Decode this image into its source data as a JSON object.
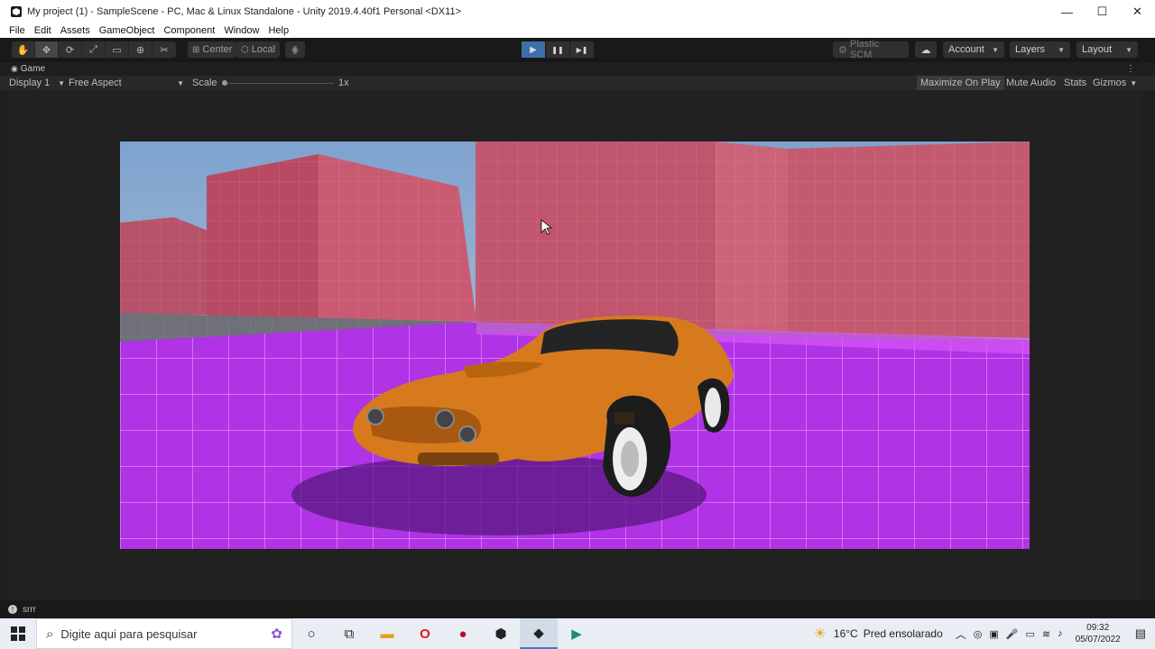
{
  "window": {
    "title": "My project (1) - SampleScene - PC, Mac & Linux Standalone - Unity 2019.4.40f1 Personal <DX11>",
    "minimize_glyph": "—",
    "maximize_glyph": "☐",
    "close_glyph": "✕"
  },
  "menu": [
    "File",
    "Edit",
    "Assets",
    "GameObject",
    "Component",
    "Window",
    "Help"
  ],
  "toolbar": {
    "tools": [
      "hand-icon",
      "move-icon",
      "rotate-icon",
      "scale-icon",
      "rect-tool-icon",
      "transform-icon",
      "custom-tool-icon"
    ],
    "tool_glyphs": [
      "✋",
      "✥",
      "⟳",
      "⤢",
      "▭",
      "⊕",
      "✂"
    ],
    "pivot_label": "Center",
    "space_label": "Local",
    "play_glyph": "▶",
    "pause_glyph": "❚❚",
    "step_glyph": "▶❚",
    "plastic_label": "Plastic SCM",
    "account_label": "Account",
    "layers_label": "Layers",
    "layout_label": "Layout"
  },
  "game_tab": {
    "label": "Game",
    "display_label": "Display 1",
    "aspect_label": "Free Aspect",
    "scale_label": "Scale",
    "scale_value": "1x",
    "maximize_label": "Maximize On Play",
    "mute_label": "Mute Audio",
    "stats_label": "Stats",
    "gizmos_label": "Gizmos"
  },
  "status": {
    "message": "srrr"
  },
  "taskbar": {
    "search_placeholder": "Digite aqui para pesquisar",
    "weather_temp": "16°C",
    "weather_text": "Pred ensolarado",
    "time": "09:32",
    "date": "05/07/2022"
  },
  "colors": {
    "play_active": "#3f6fa8",
    "floor": "#b233e8",
    "walls": "#c7556c",
    "car": "#d77a1e"
  }
}
